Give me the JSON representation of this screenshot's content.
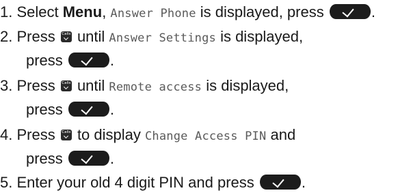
{
  "steps": [
    {
      "number": "1.",
      "t1": " Select ",
      "menu": "Menu",
      "t2": ", ",
      "lcd1": "Answer Phone",
      "t3": " is displayed, press",
      "t4": "."
    },
    {
      "number": "2.",
      "t1": " Press ",
      "t2": " until ",
      "lcd1": "Answer Settings",
      "t3": " is displayed,",
      "t4": "press",
      "t5": "."
    },
    {
      "number": "3.",
      "t1": " Press ",
      "t2": " until ",
      "lcd1": "Remote access",
      "t3": " is displayed,",
      "t4": "press",
      "t5": "."
    },
    {
      "number": "4.",
      "t1": " Press ",
      "t2": " to display ",
      "lcd1": "Change Access PIN",
      "t3": " and",
      "t4": "press",
      "t5": "."
    },
    {
      "number": "5.",
      "t1": " Enter your old 4 digit PIN and press",
      "t2": "."
    }
  ],
  "icons": {
    "ok_button": "ok-checkmark-icon",
    "calls_key": "calls-scroll-icon",
    "calls_key_text": "Calls"
  }
}
